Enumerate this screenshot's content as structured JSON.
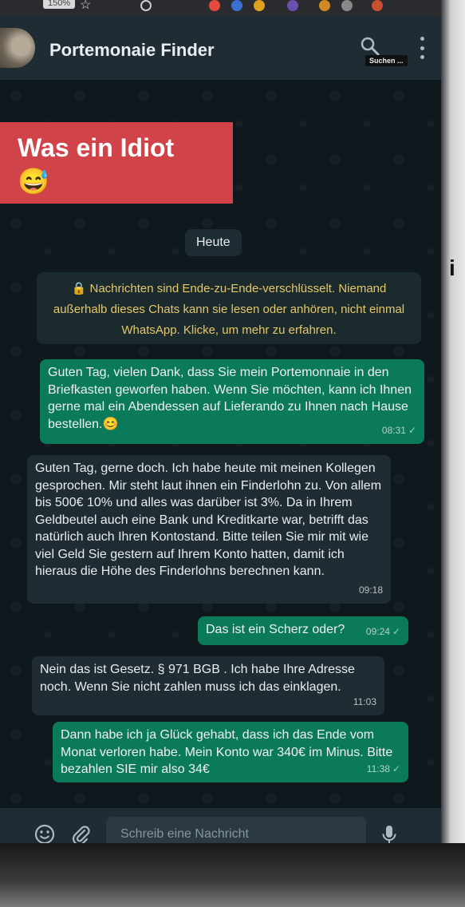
{
  "browser": {
    "zoom": "150%"
  },
  "header": {
    "chat_name": "Portemonaie Finder",
    "search_tooltip": "Suchen ..."
  },
  "banner": {
    "text": "Was ein Idiot",
    "emoji": "😅"
  },
  "date_chip": "Heute",
  "e2e_notice": "🔒 Nachrichten sind Ende-zu-Ende-verschlüsselt. Niemand außerhalb dieses Chats kann sie lesen oder anhören, nicht einmal WhatsApp. Klicke, um mehr zu erfahren.",
  "messages": [
    {
      "direction": "out",
      "text": "Guten Tag, vielen Dank, dass Sie mein Portemonnaie in den Briefkasten geworfen haben. Wenn Sie möchten, kann ich Ihnen gerne mal ein Abendessen auf Lieferando zu Ihnen nach Hause bestellen.😊",
      "time": "08:31",
      "status": "✓"
    },
    {
      "direction": "in",
      "text": "Guten Tag, gerne doch. Ich habe heute mit meinen Kollegen gesprochen. Mir steht laut ihnen ein Finderlohn zu. Von allem bis 500€ 10% und alles was darüber ist 3%. Da in Ihrem Geldbeutel auch eine Bank und Kreditkarte war, betrifft das natürlich auch Ihren Kontostand. Bitte teilen Sie mir mit wie viel Geld Sie gestern auf Ihrem Konto hatten, damit ich hieraus die Höhe des Finderlohns berechnen kann.",
      "time": "09:18"
    },
    {
      "direction": "out",
      "text": "Das ist ein Scherz oder?",
      "time": "09:24",
      "status": "✓"
    },
    {
      "direction": "in",
      "text": "Nein das ist Gesetz. § 971 BGB . Ich habe Ihre Adresse noch. Wenn Sie nicht zahlen muss ich das einklagen.",
      "time": "11:03"
    },
    {
      "direction": "out",
      "text": "Dann habe ich ja Glück gehabt, dass ich das Ende vom Monat verloren habe. Mein Konto war 340€ im Minus. Bitte bezahlen SIE mir also 34€",
      "time": "11:38",
      "status": "✓"
    }
  ],
  "composer": {
    "placeholder": "Schreib eine Nachricht"
  },
  "colors": {
    "header_bg": "#1f2c33",
    "outgoing_bubble": "#0b7a5a",
    "incoming_bubble": "#1f2c33",
    "notice_text": "#e6c76a",
    "banner_bg": "#d04349"
  }
}
